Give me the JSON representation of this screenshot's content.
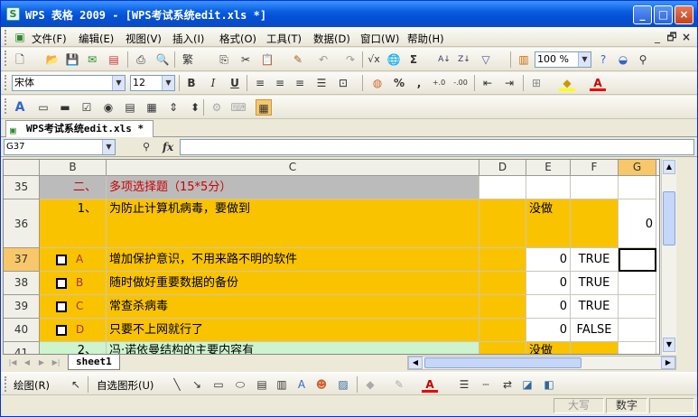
{
  "window": {
    "title": "WPS 表格 2009 - [WPS考试系统edit.xls *]",
    "controls": {
      "minimize": "_",
      "maximize": "□",
      "close": "×"
    }
  },
  "menu": {
    "items": [
      "文件(F)",
      "编辑(E)",
      "视图(V)",
      "插入(I)",
      "格式(O)",
      "工具(T)",
      "数据(D)",
      "窗口(W)",
      "帮助(H)"
    ],
    "right_controls": [
      "_",
      "🗗",
      "×"
    ]
  },
  "toolbar": {
    "zoom": "100 %",
    "traditional_label": "繁",
    "sigma": "Σ"
  },
  "format_bar": {
    "font_name": "宋体",
    "font_size": "12",
    "bold": "B",
    "italic": "I",
    "underline": "U",
    "percent": "%",
    "comma": ","
  },
  "doc_tab": {
    "label": "WPS考试系统edit.xls *"
  },
  "formula_bar": {
    "name_box": "G37",
    "fx": "fx",
    "value": ""
  },
  "columns": [
    "B",
    "C",
    "D",
    "E",
    "F",
    "G"
  ],
  "rows": [
    {
      "num": "35",
      "b": "二、",
      "c": "多项选择题（15*5分）",
      "d": "",
      "e": "",
      "f": "",
      "g": ""
    },
    {
      "num": "36",
      "b": "1、",
      "c": "为防止计算机病毒，要做到",
      "d": "",
      "e": "没做",
      "f": "",
      "g": "0"
    },
    {
      "num": "37",
      "b": "A",
      "c": "增加保护意识，不用来路不明的软件",
      "d": "",
      "e": "0",
      "f": "TRUE",
      "g": ""
    },
    {
      "num": "38",
      "b": "B",
      "c": "随时做好重要数据的备份",
      "d": "",
      "e": "0",
      "f": "TRUE",
      "g": ""
    },
    {
      "num": "39",
      "b": "C",
      "c": "常查杀病毒",
      "d": "",
      "e": "0",
      "f": "TRUE",
      "g": ""
    },
    {
      "num": "40",
      "b": "D",
      "c": "只要不上网就行了",
      "d": "",
      "e": "0",
      "f": "FALSE",
      "g": ""
    },
    {
      "num": "41",
      "b": "2、",
      "c": "冯·诺依曼结构的主要内容有",
      "d": "",
      "e": "没做",
      "f": "",
      "g": ""
    }
  ],
  "sheet_tabs": {
    "active": "sheet1"
  },
  "draw_bar": {
    "draw": "绘图(R)",
    "autoshape": "自选图形(U)"
  },
  "status": {
    "caps": "大写",
    "num": "数字"
  },
  "colors": {
    "titlebar": "#0a5fe0",
    "row_fill": "#f9c300",
    "header_active": "#f7c76a",
    "section_gray": "#bbbbbb",
    "red_text": "#cc0000"
  }
}
